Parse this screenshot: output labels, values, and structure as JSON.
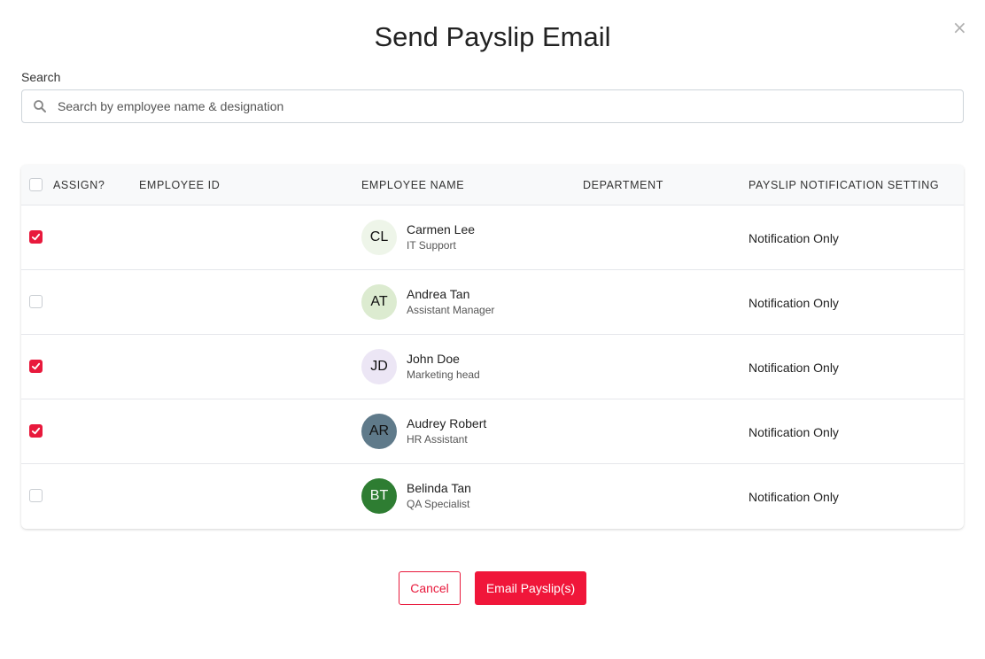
{
  "dialog": {
    "title": "Send Payslip Email",
    "close_label": "×"
  },
  "search": {
    "label": "Search",
    "placeholder": "Search by employee name & designation",
    "value": ""
  },
  "table": {
    "headers": {
      "assign": "ASSIGN?",
      "employee_id": "EMPLOYEE ID",
      "employee_name": "EMPLOYEE NAME",
      "department": "DEPARTMENT",
      "notification": "PAYSLIP NOTIFICATION SETTING"
    },
    "select_all_checked": false,
    "rows": [
      {
        "checked": true,
        "employee_id": "",
        "initials": "CL",
        "name": "Carmen Lee",
        "designation": "IT Support",
        "department": "",
        "notification": "Notification Only",
        "avatar_color": "#eef5e9"
      },
      {
        "checked": false,
        "employee_id": "",
        "initials": "AT",
        "name": "Andrea Tan",
        "designation": "Assistant Manager",
        "department": "",
        "notification": "Notification Only",
        "avatar_color": "#dcebd0"
      },
      {
        "checked": true,
        "employee_id": "",
        "initials": "JD",
        "name": "John Doe",
        "designation": "Marketing head",
        "department": "",
        "notification": "Notification Only",
        "avatar_color": "#ece6f5"
      },
      {
        "checked": true,
        "employee_id": "",
        "initials": "AR",
        "name": "Audrey Robert",
        "designation": "HR Assistant",
        "department": "",
        "notification": "Notification Only",
        "avatar_color": "#5f7a8a"
      },
      {
        "checked": false,
        "employee_id": "",
        "initials": "BT",
        "name": "Belinda Tan",
        "designation": "QA Specialist",
        "department": "",
        "notification": "Notification Only",
        "avatar_color": "#2e7d32"
      }
    ]
  },
  "footer": {
    "cancel_label": "Cancel",
    "email_label": "Email Payslip(s)"
  },
  "colors": {
    "accent": "#e8193c",
    "checkbox_checked": "#e8193c",
    "avatar_text_light": "#ffffff"
  }
}
